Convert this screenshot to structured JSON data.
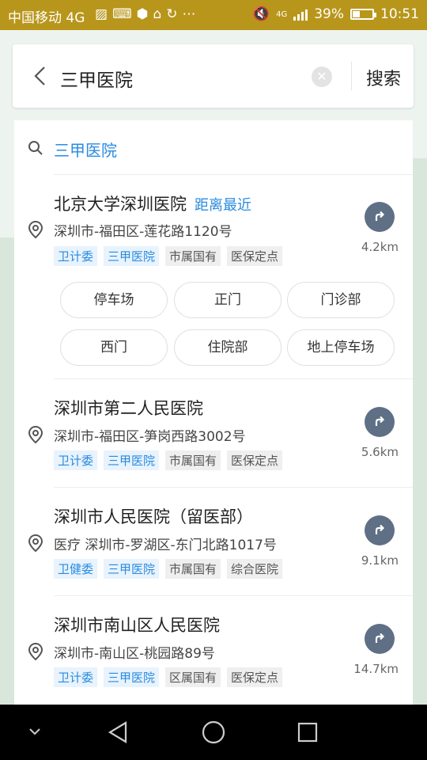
{
  "status_bar": {
    "carrier": "中国移动 4G",
    "left_icons": [
      "image-icon",
      "keyboard-icon",
      "shield-icon",
      "bag-icon",
      "sync-icon",
      "more-icon"
    ],
    "network": "4G",
    "battery": "39%",
    "battery_level": 0.39,
    "time": "10:51"
  },
  "search": {
    "query": "三甲医院",
    "search_label": "搜索"
  },
  "suggestion": {
    "text": "三甲医院"
  },
  "results": [
    {
      "name": "北京大学深圳医院",
      "badge": "距离最近",
      "address": "深圳市-福田区-莲花路1120号",
      "tags": [
        "卫计委",
        "三甲医院",
        "市属国有",
        "医保定点"
      ],
      "distance": "4.2km",
      "subpois": [
        "停车场",
        "正门",
        "门诊部",
        "西门",
        "住院部",
        "地上停车场"
      ]
    },
    {
      "name": "深圳市第二人民医院",
      "badge": "",
      "address": "深圳市-福田区-笋岗西路3002号",
      "tags": [
        "卫计委",
        "三甲医院",
        "市属国有",
        "医保定点"
      ],
      "distance": "5.6km"
    },
    {
      "name": "深圳市人民医院（留医部）",
      "badge": "",
      "address": "医疗   深圳市-罗湖区-东门北路1017号",
      "tags": [
        "卫健委",
        "三甲医院",
        "市属国有",
        "综合医院"
      ],
      "distance": "9.1km"
    },
    {
      "name": "深圳市南山区人民医院",
      "badge": "",
      "address": "深圳市-南山区-桃园路89号",
      "tags": [
        "卫计委",
        "三甲医院",
        "区属国有",
        "医保定点"
      ],
      "distance": "14.7km"
    }
  ],
  "colors": {
    "status_bar": "#b8961b",
    "accent_blue": "#2a8be0",
    "route_button": "#5f6f85"
  }
}
